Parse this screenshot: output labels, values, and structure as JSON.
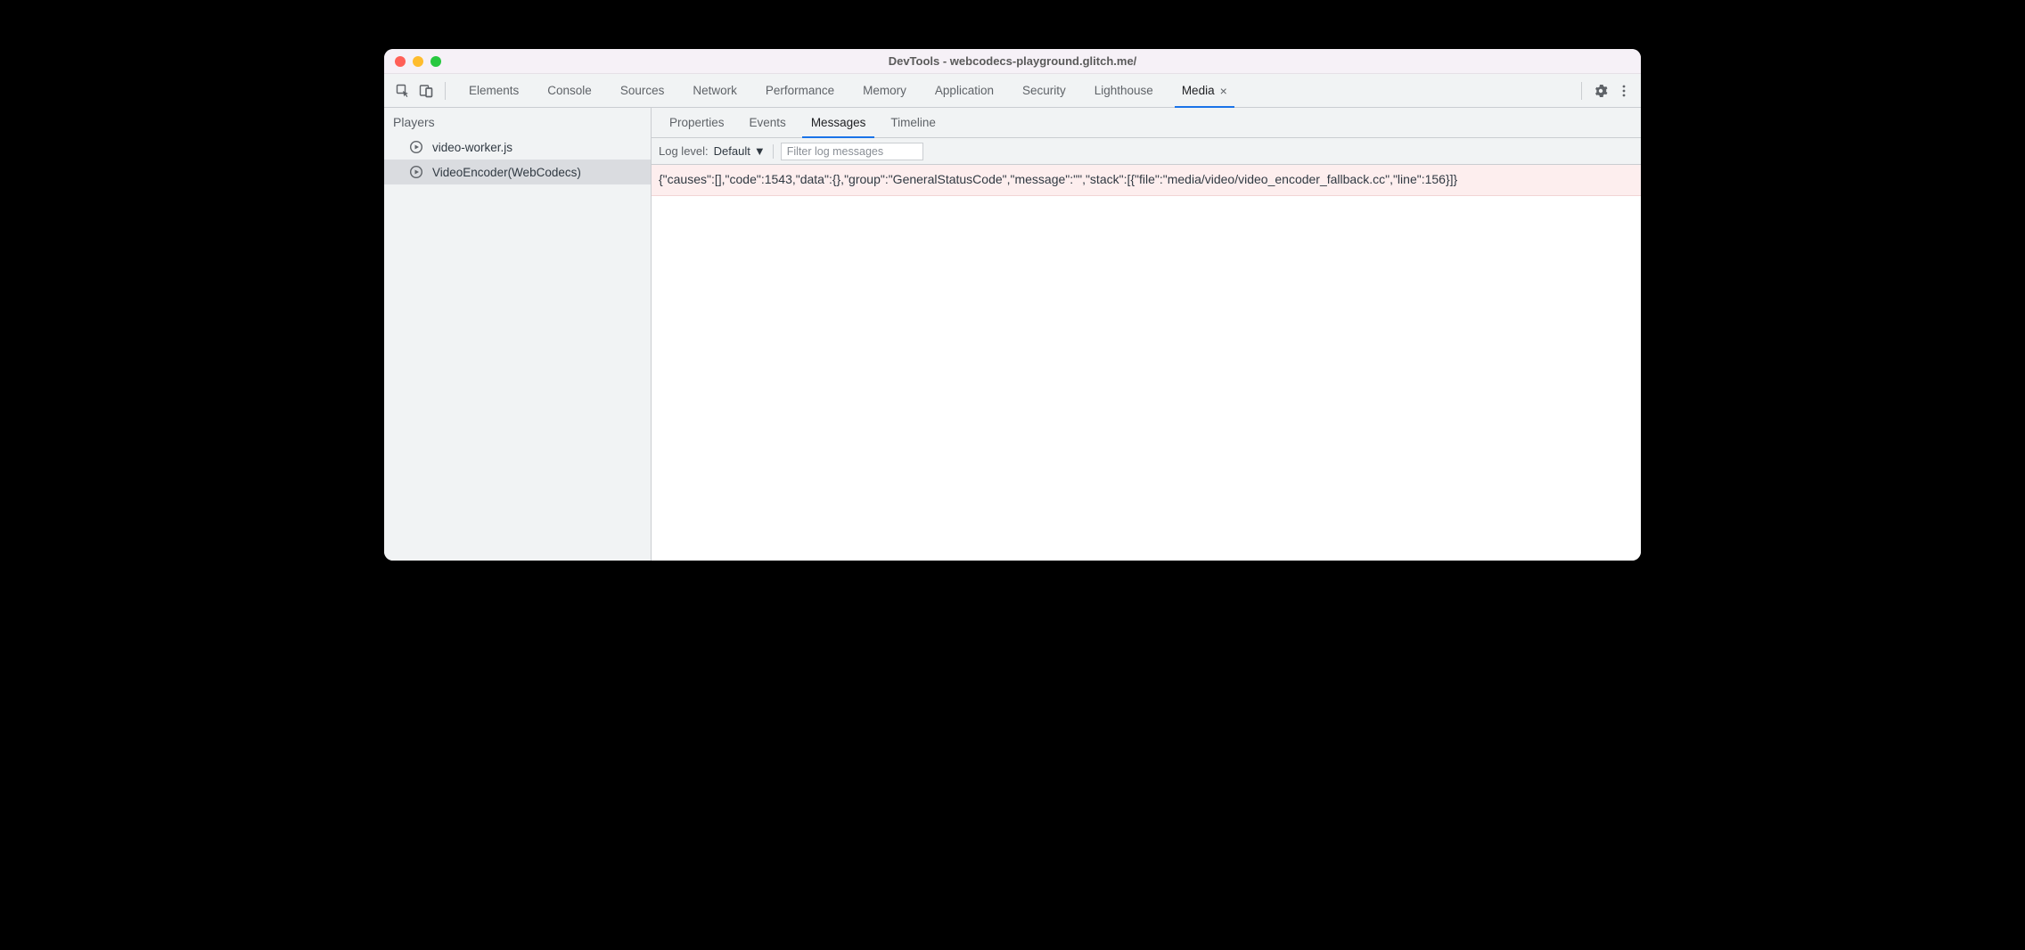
{
  "window": {
    "title": "DevTools - webcodecs-playground.glitch.me/"
  },
  "topTabs": {
    "items": [
      {
        "label": "Elements"
      },
      {
        "label": "Console"
      },
      {
        "label": "Sources"
      },
      {
        "label": "Network"
      },
      {
        "label": "Performance"
      },
      {
        "label": "Memory"
      },
      {
        "label": "Application"
      },
      {
        "label": "Security"
      },
      {
        "label": "Lighthouse"
      },
      {
        "label": "Media"
      }
    ],
    "activeIndex": 9,
    "closable": true
  },
  "sidebar": {
    "title": "Players",
    "items": [
      {
        "label": "video-worker.js"
      },
      {
        "label": "VideoEncoder(WebCodecs)"
      }
    ],
    "selectedIndex": 1
  },
  "subTabs": {
    "items": [
      {
        "label": "Properties"
      },
      {
        "label": "Events"
      },
      {
        "label": "Messages"
      },
      {
        "label": "Timeline"
      }
    ],
    "activeIndex": 2
  },
  "filter": {
    "log_level_label": "Log level:",
    "log_level_value": "Default",
    "placeholder": "Filter log messages"
  },
  "messages": {
    "rows": [
      {
        "text": "{\"causes\":[],\"code\":1543,\"data\":{},\"group\":\"GeneralStatusCode\",\"message\":\"\",\"stack\":[{\"file\":\"media/video/video_encoder_fallback.cc\",\"line\":156}]}"
      }
    ]
  }
}
